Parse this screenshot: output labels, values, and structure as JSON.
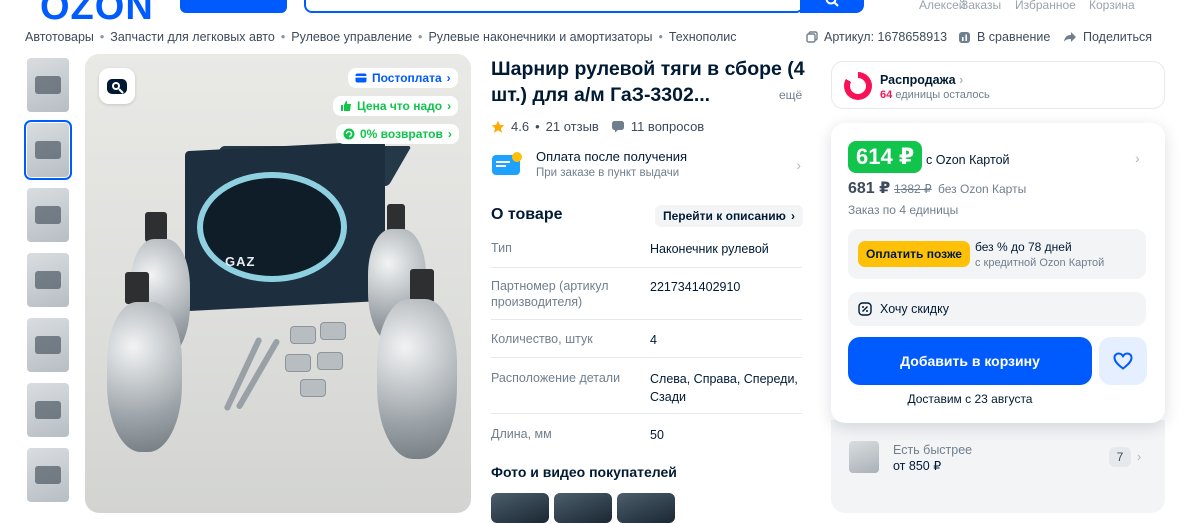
{
  "header": {
    "logo": "OZON",
    "links": [
      "Алексей",
      "Заказы",
      "Избранное",
      "Корзина"
    ]
  },
  "breadcrumbs": [
    "Автотовары",
    "Запчасти для легковых авто",
    "Рулевое управление",
    "Рулевые наконечники и амортизаторы",
    "Технополис"
  ],
  "meta": {
    "article": "Артикул: 1678658913",
    "compare": "В сравнение",
    "share": "Поделиться"
  },
  "gallery": {
    "badges": [
      "Постоплата",
      "Цена что надо",
      "0% возвратов"
    ],
    "thumbnail_count": 7,
    "active_thumbnail": 2
  },
  "product": {
    "title": "Шарнир рулевой тяги в сборе (4 шт.) для а/м ГаЗ-3302...",
    "more": "ещё",
    "rating": "4.6",
    "reviews": "21 отзыв",
    "questions": "11 вопросов"
  },
  "payment": {
    "title": "Оплата после получения",
    "subtitle": "При заказе в пункт выдачи"
  },
  "about": {
    "title": "О товаре",
    "button": "Перейти к описанию",
    "specs": [
      {
        "key": "Тип",
        "value": "Наконечник рулевой"
      },
      {
        "key": "Партномер (артикул производителя)",
        "value": "2217341402910"
      },
      {
        "key": "Количество, штук",
        "value": "4"
      },
      {
        "key": "Расположение детали",
        "value": "Слева, Справа, Спереди, Сзади"
      },
      {
        "key": "Длина, мм",
        "value": "50"
      }
    ]
  },
  "photos_title": "Фото и видео покупателей",
  "sale": {
    "title": "Распродажа",
    "count": "64",
    "count_suffix": "единицы осталось"
  },
  "pricing": {
    "price": "614 ₽",
    "price_label": "с Ozon Картой",
    "alt_price": "681 ₽",
    "old_price": "1382 ₽",
    "alt_label": "без Ozon Карты",
    "order_note": "Заказ по 4 единицы",
    "later_button": "Оплатить позже",
    "later_text1": "без % до 78 дней",
    "later_text2": "с кредитной Ozon Картой",
    "discount": "Хочу скидку",
    "cart_button": "Добавить в корзину",
    "delivery": "Доставим с 23 августа"
  },
  "faster": {
    "label": "Есть быстрее",
    "price": "от 850 ₽",
    "count": "7"
  },
  "colors": {
    "brand": "#005bff",
    "green": "#10c44c",
    "pink": "#f91155",
    "yellow": "#ffc107"
  }
}
